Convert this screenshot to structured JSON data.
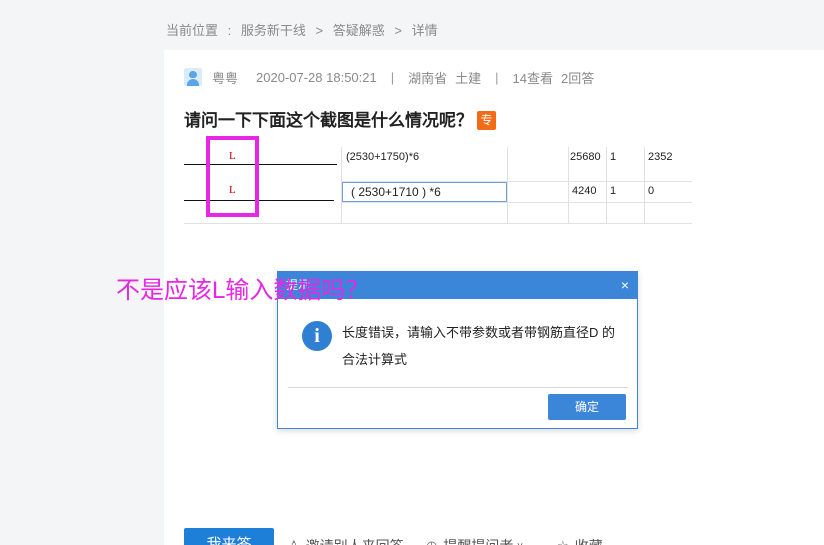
{
  "breadcrumb": {
    "label": "当前位置",
    "colon": ":",
    "items": [
      "服务新干线",
      ">",
      "答疑解惑",
      ">",
      "详情"
    ]
  },
  "meta": {
    "user": "粤粤",
    "datetime": "2020-07-28 18:50:21",
    "sep1": "|",
    "province": "湖南省",
    "category": "土建",
    "sep2": "|",
    "views": "14查看",
    "answers": "2回答"
  },
  "question": {
    "title": "请问一下下面这个截图是什么情况呢？",
    "badge": "专"
  },
  "screenshot": {
    "row1_L": "L",
    "row1_formula": "(2530+1750)*6",
    "row1_v1": "25680",
    "row1_v2": "1",
    "row1_v3": "2352",
    "row2_L": "L",
    "row2_formula": "( 2530+1710 ) *6",
    "row2_v1": "4240",
    "row2_v2": "1",
    "row2_v3": "0"
  },
  "annotation": "不是应该L输入数据吗？",
  "dialog": {
    "title": "提示",
    "close": "×",
    "icon": "i",
    "message": "长度错误，请输入不带参数或者带钢筋直径D 的合法计算式",
    "ok_label": "确定"
  },
  "actions": {
    "answer_label": "我来答",
    "invite_label": "邀请别人来回答",
    "remind_label": "提醒提问者",
    "favorite_label": "收藏"
  },
  "colors": {
    "accent": "#3b86d8",
    "annotation": "#e628e6",
    "badge": "#f46b17"
  }
}
